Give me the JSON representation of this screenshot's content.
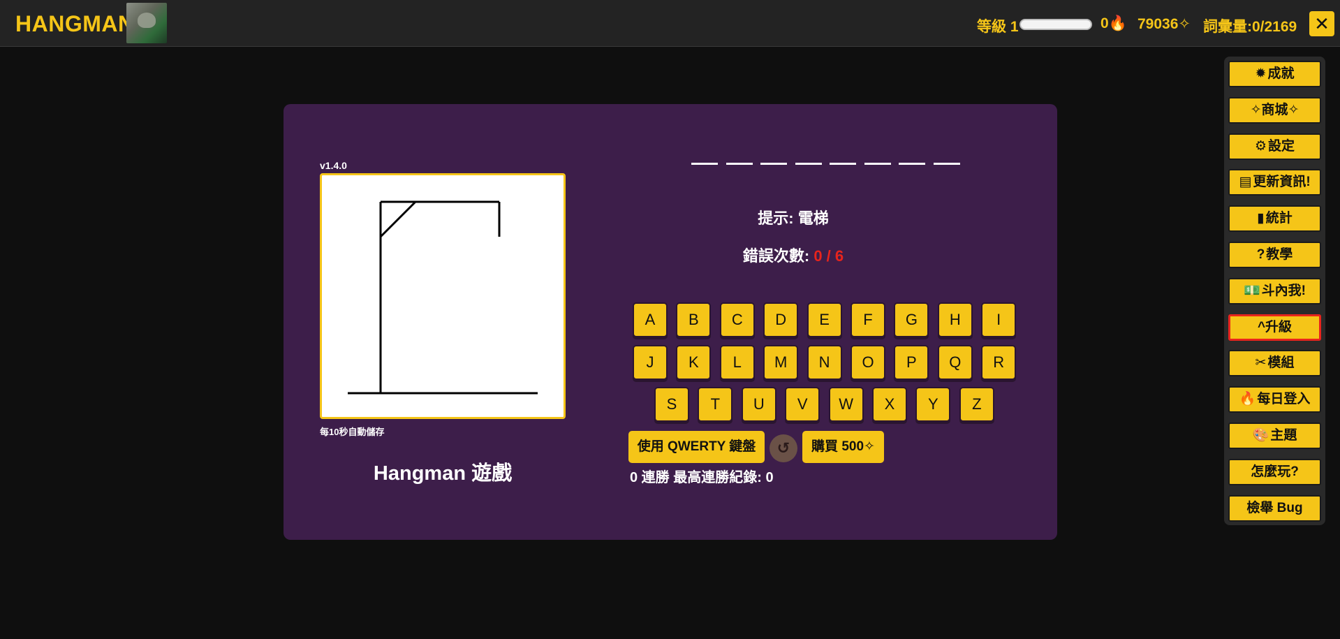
{
  "header": {
    "brand": "HANGMAN",
    "level_label": "等級 1",
    "level_progress": 0,
    "fire_count": "0",
    "fire_icon": "flame-icon",
    "coins": "79036✧",
    "vocab": "詞彙量:0/2169",
    "close_label": "✕"
  },
  "game": {
    "version": "v1.4.0",
    "autosave": "每10秒自動儲存",
    "title": "Hangman 遊戲",
    "word_length": 8,
    "hint": "提示: 電梯",
    "errors_label": "錯誤次數: ",
    "errors_count": "0 / 6",
    "keys_row1": [
      "A",
      "B",
      "C",
      "D",
      "E",
      "F",
      "G",
      "H",
      "I"
    ],
    "keys_row2": [
      "J",
      "K",
      "L",
      "M",
      "N",
      "O",
      "P",
      "Q",
      "R"
    ],
    "keys_row3": [
      "S",
      "T",
      "U",
      "V",
      "W",
      "X",
      "Y",
      "Z"
    ],
    "qwerty_label": "使用 QWERTY 鍵盤",
    "reset_icon": "↺",
    "buy_label": "購買 500✧",
    "streak": "0 連勝 最高連勝紀錄: 0"
  },
  "side_menu": [
    {
      "label": "成就",
      "icon": "✹"
    },
    {
      "label": "✧商城✧",
      "icon": ""
    },
    {
      "label": "設定",
      "icon": "⚙"
    },
    {
      "label": "更新資訊!",
      "icon": "▤"
    },
    {
      "label": "統計",
      "icon": "▮"
    },
    {
      "label": "教學",
      "icon": "?"
    },
    {
      "label": "斗內我!",
      "icon": "💵"
    },
    {
      "label": "^升級",
      "icon": ""
    },
    {
      "label": "模組",
      "icon": "✂"
    },
    {
      "label": "每日登入",
      "icon": "🔥"
    },
    {
      "label": "主題",
      "icon": "🎨"
    },
    {
      "label": "怎麼玩?",
      "icon": ""
    },
    {
      "label": "檢舉 Bug",
      "icon": ""
    }
  ],
  "colors": {
    "accent": "#f5c518",
    "panel": "#3d1e4a",
    "error": "#e8241c"
  }
}
